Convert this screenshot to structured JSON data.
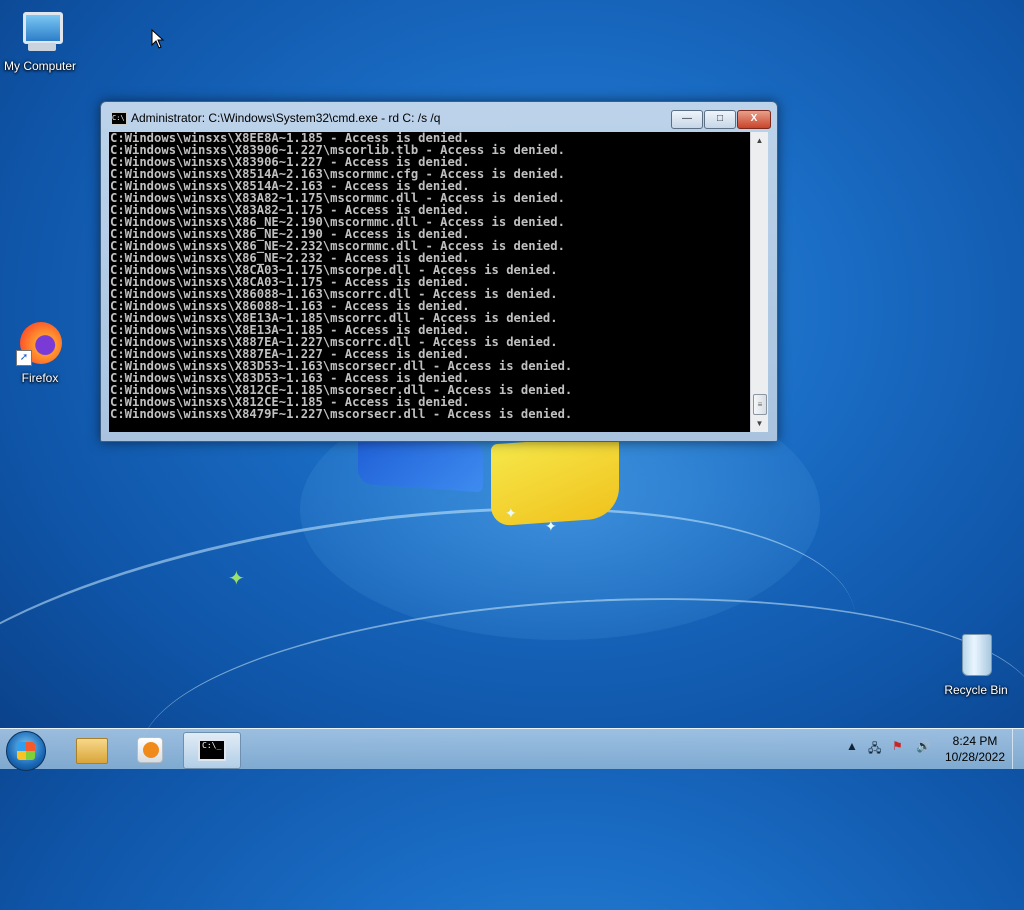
{
  "desktop": {
    "icons": [
      {
        "label": "My Computer"
      },
      {
        "label": "Firefox"
      },
      {
        "label": "Recycle Bin"
      }
    ]
  },
  "cmd_window": {
    "title": "Administrator: C:\\Windows\\System32\\cmd.exe - rd  C: /s /q",
    "buttons": {
      "minimize": "—",
      "maximize": "□",
      "close": "X"
    },
    "console_lines": [
      "C:Windows\\winsxs\\X8EE8A~1.185 - Access is denied.",
      "C:Windows\\winsxs\\X83906~1.227\\mscorlib.tlb - Access is denied.",
      "C:Windows\\winsxs\\X83906~1.227 - Access is denied.",
      "C:Windows\\winsxs\\X8514A~2.163\\mscormmc.cfg - Access is denied.",
      "C:Windows\\winsxs\\X8514A~2.163 - Access is denied.",
      "C:Windows\\winsxs\\X83A82~1.175\\mscormmc.dll - Access is denied.",
      "C:Windows\\winsxs\\X83A82~1.175 - Access is denied.",
      "C:Windows\\winsxs\\X86_NE~2.190\\mscormmc.dll - Access is denied.",
      "C:Windows\\winsxs\\X86_NE~2.190 - Access is denied.",
      "C:Windows\\winsxs\\X86_NE~2.232\\mscormmc.dll - Access is denied.",
      "C:Windows\\winsxs\\X86_NE~2.232 - Access is denied.",
      "C:Windows\\winsxs\\X8CA03~1.175\\mscorpe.dll - Access is denied.",
      "C:Windows\\winsxs\\X8CA03~1.175 - Access is denied.",
      "C:Windows\\winsxs\\X86088~1.163\\mscorrc.dll - Access is denied.",
      "C:Windows\\winsxs\\X86088~1.163 - Access is denied.",
      "C:Windows\\winsxs\\X8E13A~1.185\\mscorrc.dll - Access is denied.",
      "C:Windows\\winsxs\\X8E13A~1.185 - Access is denied.",
      "C:Windows\\winsxs\\X887EA~1.227\\mscorrc.dll - Access is denied.",
      "C:Windows\\winsxs\\X887EA~1.227 - Access is denied.",
      "C:Windows\\winsxs\\X83D53~1.163\\mscorsecr.dll - Access is denied.",
      "C:Windows\\winsxs\\X83D53~1.163 - Access is denied.",
      "C:Windows\\winsxs\\X812CE~1.185\\mscorsecr.dll - Access is denied.",
      "C:Windows\\winsxs\\X812CE~1.185 - Access is denied.",
      "C:Windows\\winsxs\\X8479F~1.227\\mscorsecr.dll - Access is denied."
    ]
  },
  "taskbar": {
    "clock_time": "8:24 PM",
    "clock_date": "10/28/2022",
    "cmd_icon_text": "C:\\_"
  }
}
